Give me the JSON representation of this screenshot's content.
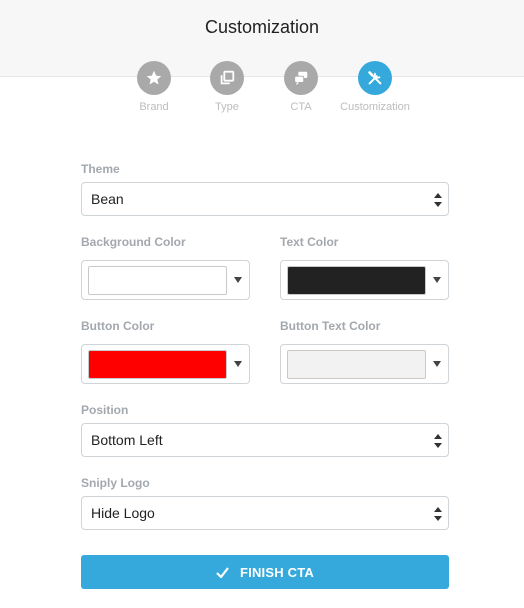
{
  "header": {
    "title": "Customization"
  },
  "steps": [
    {
      "label": "Brand",
      "icon": "star-icon",
      "active": false
    },
    {
      "label": "Type",
      "icon": "copy-icon",
      "active": false
    },
    {
      "label": "CTA",
      "icon": "chat-bubbles-icon",
      "active": false
    },
    {
      "label": "Customization",
      "icon": "tools-icon",
      "active": true
    }
  ],
  "form": {
    "theme": {
      "label": "Theme",
      "value": "Bean"
    },
    "background_color": {
      "label": "Background Color",
      "value": "#ffffff"
    },
    "text_color": {
      "label": "Text Color",
      "value": "#222222"
    },
    "button_color": {
      "label": "Button Color",
      "value": "#ff0000"
    },
    "button_text_color": {
      "label": "Button Text Color",
      "value": "#f2f2f2"
    },
    "position": {
      "label": "Position",
      "value": "Bottom Left"
    },
    "logo": {
      "label": "Sniply Logo",
      "value": "Hide Logo"
    }
  },
  "finish_button": {
    "label": "FINISH CTA",
    "icon": "check-icon"
  },
  "colors": {
    "accent": "#36a9dc",
    "step_inactive": "#a9a9a9"
  }
}
